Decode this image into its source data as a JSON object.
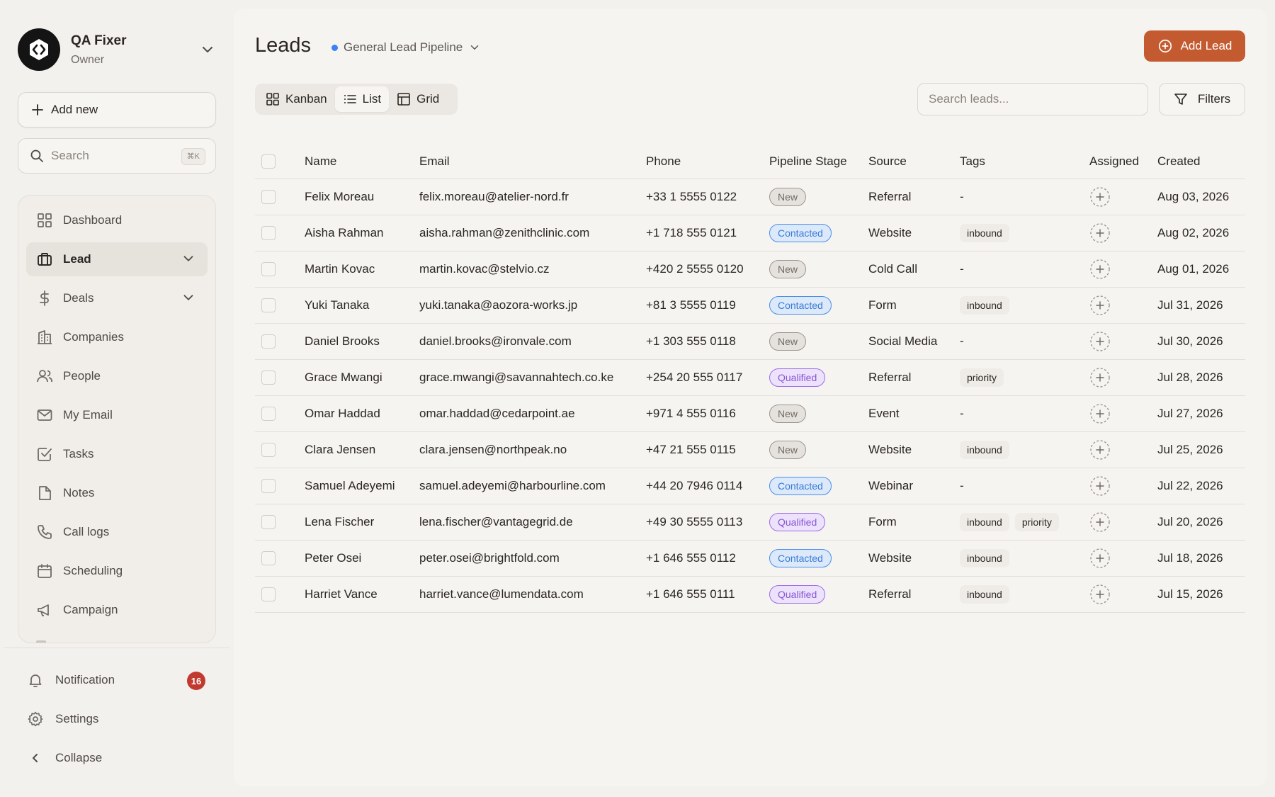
{
  "profile": {
    "name": "QA Fixer",
    "role": "Owner"
  },
  "sidebar": {
    "add_new_label": "Add new",
    "search_placeholder": "Search",
    "search_shortcut": "⌘K",
    "items": [
      {
        "label": "Dashboard",
        "icon": "dashboard-icon"
      },
      {
        "label": "Lead",
        "icon": "briefcase-icon",
        "active": true,
        "expandable": true
      },
      {
        "label": "Deals",
        "icon": "dollar-icon",
        "expandable": true
      },
      {
        "label": "Companies",
        "icon": "building-icon"
      },
      {
        "label": "People",
        "icon": "people-icon"
      },
      {
        "label": "My Email",
        "icon": "mail-icon"
      },
      {
        "label": "Tasks",
        "icon": "checkbox-icon"
      },
      {
        "label": "Notes",
        "icon": "note-icon"
      },
      {
        "label": "Call logs",
        "icon": "phone-icon"
      },
      {
        "label": "Scheduling",
        "icon": "calendar-icon"
      },
      {
        "label": "Campaign",
        "icon": "megaphone-icon"
      }
    ],
    "bottom": {
      "notification_label": "Notification",
      "notification_count": "16",
      "settings_label": "Settings",
      "collapse_label": "Collapse"
    }
  },
  "header": {
    "title": "Leads",
    "pipeline_label": "General Lead Pipeline",
    "add_lead_label": "Add Lead"
  },
  "views": {
    "kanban": "Kanban",
    "list": "List",
    "grid": "Grid",
    "active": "List"
  },
  "search": {
    "placeholder": "Search leads..."
  },
  "filters_label": "Filters",
  "table": {
    "columns": {
      "name": "Name",
      "email": "Email",
      "phone": "Phone",
      "stage": "Pipeline Stage",
      "source": "Source",
      "tags": "Tags",
      "assigned": "Assigned",
      "created": "Created"
    },
    "rows": [
      {
        "name": "Felix Moreau",
        "email": "felix.moreau@atelier-nord.fr",
        "phone": "+33 1 5555 0122",
        "stage": "New",
        "source": "Referral",
        "tags": [],
        "created": "Aug 03, 2026"
      },
      {
        "name": "Aisha Rahman",
        "email": "aisha.rahman@zenithclinic.com",
        "phone": "+1 718 555 0121",
        "stage": "Contacted",
        "source": "Website",
        "tags": [
          "inbound"
        ],
        "created": "Aug 02, 2026"
      },
      {
        "name": "Martin Kovac",
        "email": "martin.kovac@stelvio.cz",
        "phone": "+420 2 5555 0120",
        "stage": "New",
        "source": "Cold Call",
        "tags": [],
        "created": "Aug 01, 2026"
      },
      {
        "name": "Yuki Tanaka",
        "email": "yuki.tanaka@aozora-works.jp",
        "phone": "+81 3 5555 0119",
        "stage": "Contacted",
        "source": "Form",
        "tags": [
          "inbound"
        ],
        "created": "Jul 31, 2026"
      },
      {
        "name": "Daniel Brooks",
        "email": "daniel.brooks@ironvale.com",
        "phone": "+1 303 555 0118",
        "stage": "New",
        "source": "Social Media",
        "tags": [],
        "created": "Jul 30, 2026"
      },
      {
        "name": "Grace Mwangi",
        "email": "grace.mwangi@savannahtech.co.ke",
        "phone": "+254 20 555 0117",
        "stage": "Qualified",
        "source": "Referral",
        "tags": [
          "priority"
        ],
        "created": "Jul 28, 2026"
      },
      {
        "name": "Omar Haddad",
        "email": "omar.haddad@cedarpoint.ae",
        "phone": "+971 4 555 0116",
        "stage": "New",
        "source": "Event",
        "tags": [],
        "created": "Jul 27, 2026"
      },
      {
        "name": "Clara Jensen",
        "email": "clara.jensen@northpeak.no",
        "phone": "+47 21 555 0115",
        "stage": "New",
        "source": "Website",
        "tags": [
          "inbound"
        ],
        "created": "Jul 25, 2026"
      },
      {
        "name": "Samuel Adeyemi",
        "email": "samuel.adeyemi@harbourline.com",
        "phone": "+44 20 7946 0114",
        "stage": "Contacted",
        "source": "Webinar",
        "tags": [],
        "created": "Jul 22, 2026"
      },
      {
        "name": "Lena Fischer",
        "email": "lena.fischer@vantagegrid.de",
        "phone": "+49 30 5555 0113",
        "stage": "Qualified",
        "source": "Form",
        "tags": [
          "inbound",
          "priority"
        ],
        "created": "Jul 20, 2026"
      },
      {
        "name": "Peter Osei",
        "email": "peter.osei@brightfold.com",
        "phone": "+1 646 555 0112",
        "stage": "Contacted",
        "source": "Website",
        "tags": [
          "inbound"
        ],
        "created": "Jul 18, 2026"
      },
      {
        "name": "Harriet Vance",
        "email": "harriet.vance@lumendata.com",
        "phone": "+1 646 555 0111",
        "stage": "Qualified",
        "source": "Referral",
        "tags": [
          "inbound"
        ],
        "created": "Jul 15, 2026"
      }
    ],
    "empty_tags": "-"
  },
  "colors": {
    "accent": "#c45b30",
    "badge_red": "#c2392f",
    "stage_new": "#9b958f",
    "stage_contacted": "#4a8ee6",
    "stage_qualified": "#9e6be6",
    "pipeline_dot": "#3b82f6"
  }
}
